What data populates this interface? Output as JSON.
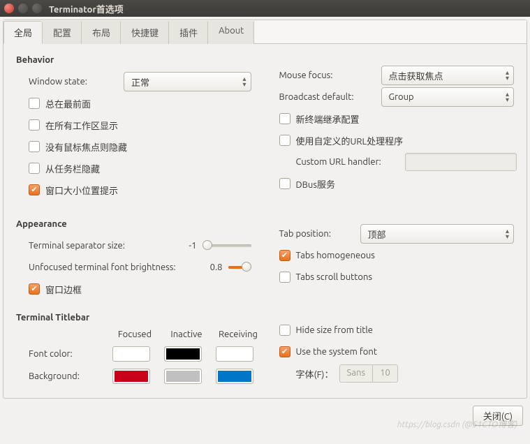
{
  "window": {
    "title": "Terminator首选项"
  },
  "tabs": {
    "global": "全局",
    "profiles": "配置",
    "layouts": "布局",
    "keybindings": "快捷键",
    "plugins": "插件",
    "about": "About"
  },
  "behavior": {
    "title": "Behavior",
    "window_state_label": "Window state:",
    "window_state_value": "正常",
    "always_on_top": "总在最前面",
    "show_on_all_workspaces": "在所有工作区显示",
    "hide_on_lose_focus": "没有鼠标焦点则隐藏",
    "hide_from_taskbar": "从任务栏隐藏",
    "geometry_hints": "窗口大小位置提示",
    "mouse_focus_label": "Mouse focus:",
    "mouse_focus_value": "点击获取焦点",
    "broadcast_default_label": "Broadcast default:",
    "broadcast_default_value": "Group",
    "reuse_profiles": "新终端继承配置",
    "use_custom_url_handler": "使用自定义的URL处理程序",
    "custom_url_handler_label": "Custom URL handler:",
    "custom_url_handler_value": "",
    "dbus_server": "DBus服务"
  },
  "appearance": {
    "title": "Appearance",
    "separator_size_label": "Terminal separator size:",
    "separator_size_value": "-1",
    "unfocused_brightness_label": "Unfocused terminal font brightness:",
    "unfocused_brightness_value": "0.8",
    "window_borders": "窗口边框",
    "tab_position_label": "Tab position:",
    "tab_position_value": "顶部",
    "tabs_homogeneous": "Tabs homogeneous",
    "tabs_scroll_buttons": "Tabs scroll buttons"
  },
  "titlebar": {
    "title": "Terminal Titlebar",
    "col_focused": "Focused",
    "col_inactive": "Inactive",
    "col_receiving": "Receiving",
    "font_color_label": "Font color:",
    "background_label": "Background:",
    "colors": {
      "font_focused": "#ffffff",
      "font_inactive": "#000000",
      "font_receiving": "#ffffff",
      "bg_focused": "#c8001a",
      "bg_inactive": "#c0c0c0",
      "bg_receiving": "#0076c8"
    },
    "hide_size_from_title": "Hide size from title",
    "use_system_font": "Use the system font",
    "font_label": "字体(F)：",
    "font_family": "Sans",
    "font_size": "10"
  },
  "footer": {
    "close": "关闭(C)"
  },
  "watermark": "https://blog.csdn (@51CTO博客)"
}
